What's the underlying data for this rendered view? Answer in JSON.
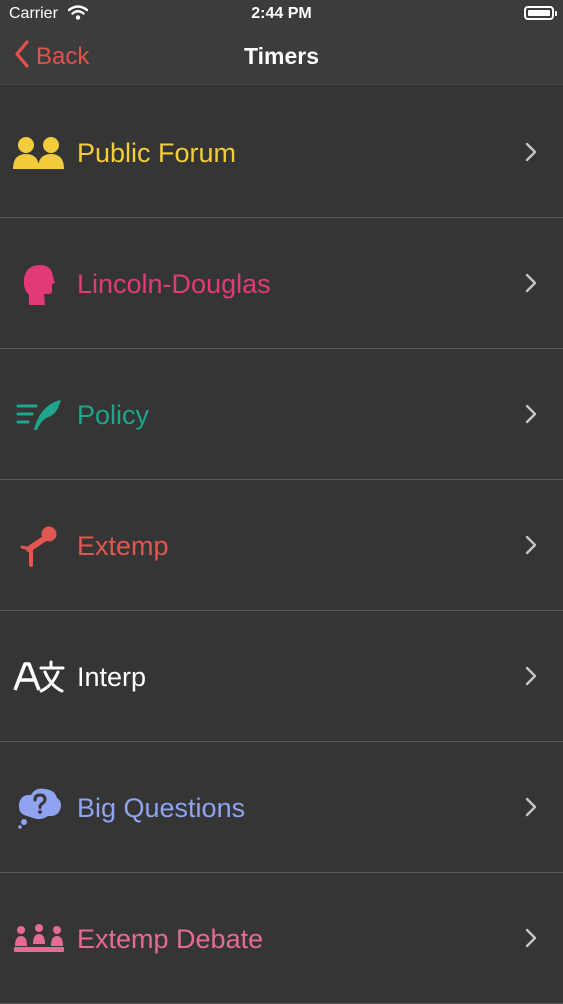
{
  "status_bar": {
    "carrier": "Carrier",
    "time": "2:44 PM"
  },
  "nav": {
    "back_label": "Back",
    "title": "Timers",
    "accent_color": "#e0524c"
  },
  "items": [
    {
      "label": "Public Forum",
      "icon": "two-people-icon",
      "color": "#f2cc3a"
    },
    {
      "label": "Lincoln-Douglas",
      "icon": "head-profile-icon",
      "color": "#e23a78"
    },
    {
      "label": "Policy",
      "icon": "quill-lines-icon",
      "color": "#1fa58c"
    },
    {
      "label": "Extemp",
      "icon": "microphone-stand-icon",
      "color": "#e0574f"
    },
    {
      "label": "Interp",
      "icon": "translate-icon",
      "color": "#ffffff"
    },
    {
      "label": "Big Questions",
      "icon": "question-bubble-icon",
      "color": "#8fa3f0"
    },
    {
      "label": "Extemp Debate",
      "icon": "audience-icon",
      "color": "#e56b93"
    }
  ]
}
